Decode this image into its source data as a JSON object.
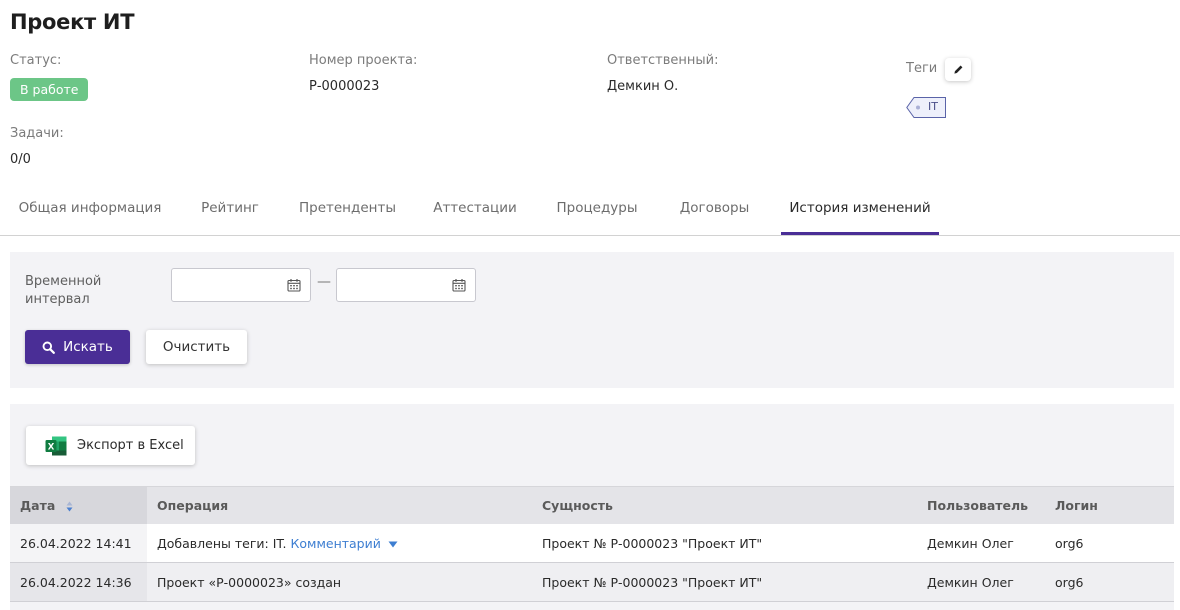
{
  "page": {
    "title": "Проект ИТ"
  },
  "meta": {
    "status_label": "Статус:",
    "status_value": "В работе",
    "number_label": "Номер проекта:",
    "number_value": "Р-0000023",
    "responsible_label": "Ответственный:",
    "responsible_value": "Демкин О.",
    "tags_label": "Теги",
    "tags": [
      "IT"
    ],
    "tasks_label": "Задачи:",
    "tasks_value": "0/0"
  },
  "tabs": [
    {
      "label": "Общая информация"
    },
    {
      "label": "Рейтинг"
    },
    {
      "label": "Претенденты"
    },
    {
      "label": "Аттестации"
    },
    {
      "label": "Процедуры"
    },
    {
      "label": "Договоры"
    },
    {
      "label": "История изменений",
      "active": true
    }
  ],
  "filter": {
    "interval_label": "Временной интервал",
    "date_from": "",
    "date_to": "",
    "separator": "—",
    "search_label": "Искать",
    "clear_label": "Очистить"
  },
  "export": {
    "label": "Экспорт в Excel"
  },
  "table": {
    "columns": [
      "Дата",
      "Операция",
      "Сущность",
      "Пользователь",
      "Логин"
    ],
    "rows": [
      {
        "date": "26.04.2022 14:41",
        "operation": "Добавлены теги: IT.",
        "comment_link": "Комментарий",
        "entity": "Проект № Р-0000023 \"Проект ИТ\"",
        "user": "Демкин Олег",
        "login": "org6"
      },
      {
        "date": "26.04.2022 14:36",
        "operation": "Проект «Р-0000023» создан",
        "entity": "Проект № Р-0000023 \"Проект ИТ\"",
        "user": "Демкин Олег",
        "login": "org6"
      }
    ]
  },
  "colors": {
    "accent": "#4a2e96",
    "status": "#6cc687",
    "link": "#3d7ed1",
    "excel": "#1d6f42"
  },
  "icons": {
    "edit": "pencil-icon",
    "calendar": "calendar-icon",
    "search": "search-icon",
    "excel": "excel-icon",
    "sort": "sort-icon",
    "dropdown": "caret-down-icon"
  }
}
